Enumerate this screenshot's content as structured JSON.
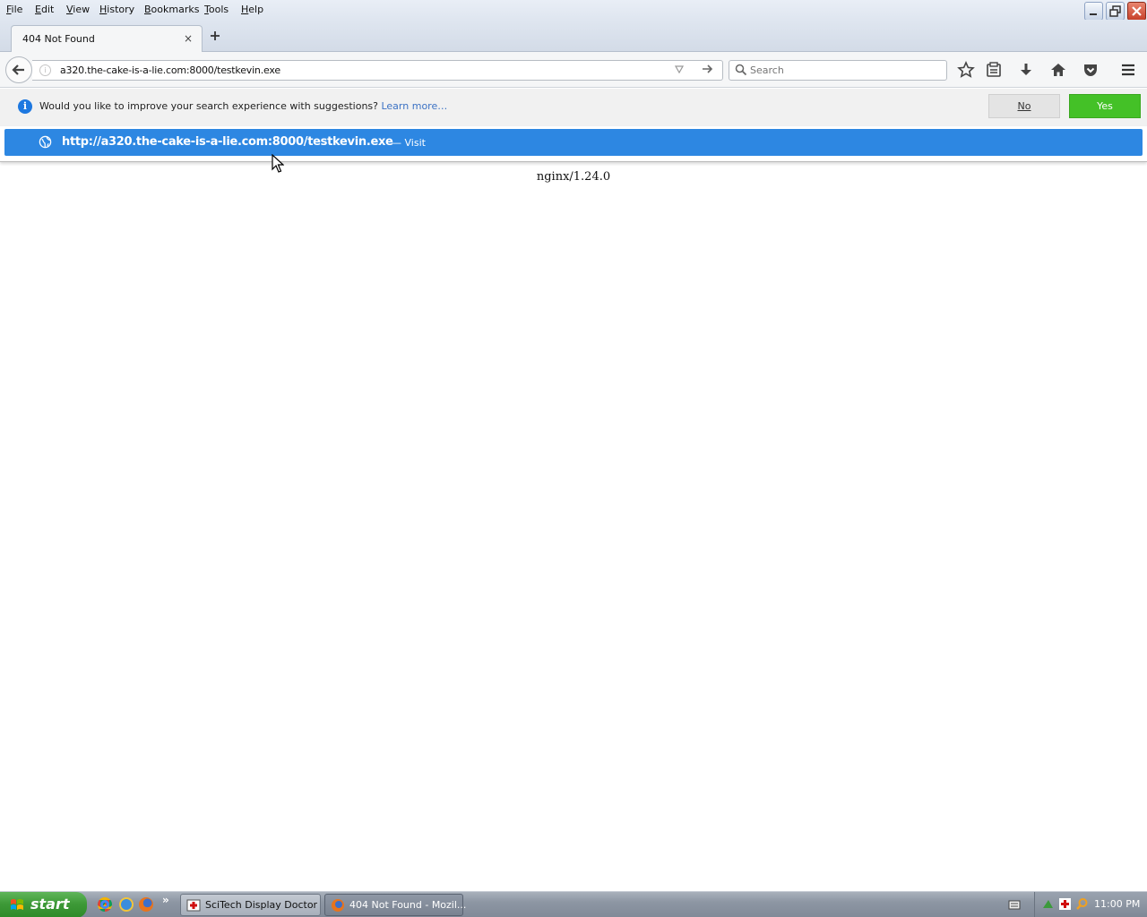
{
  "menubar": {
    "items": [
      "File",
      "Edit",
      "View",
      "History",
      "Bookmarks",
      "Tools",
      "Help"
    ]
  },
  "tabs": [
    {
      "title": "404 Not Found",
      "close": "×",
      "active": true
    }
  ],
  "navbar": {
    "url": "a320.the-cake-is-a-lie.com:8000/testkevin.exe",
    "search_placeholder": "Search"
  },
  "notification": {
    "message": "Would you like to improve your search experience with suggestions?",
    "learn_more": "Learn more…",
    "no_label": "No",
    "yes_label": "Yes"
  },
  "autocomplete": {
    "url": "http://a320.the-cake-is-a-lie.com:8000/testkevin.exe",
    "action": "— Visit"
  },
  "page": {
    "server_text": "nginx/1.24.0"
  },
  "taskbar": {
    "start_label": "start",
    "more": "»",
    "tasks": [
      {
        "label": "SciTech Display Doctor",
        "active": false
      },
      {
        "label": "404 Not Found - Mozil...",
        "active": true
      }
    ],
    "clock": "11:00 PM"
  },
  "colors": {
    "accent": "#2d87e2",
    "yes_green": "#44c127",
    "start_green": "#3e9a38",
    "info_blue": "#1d78e0"
  }
}
